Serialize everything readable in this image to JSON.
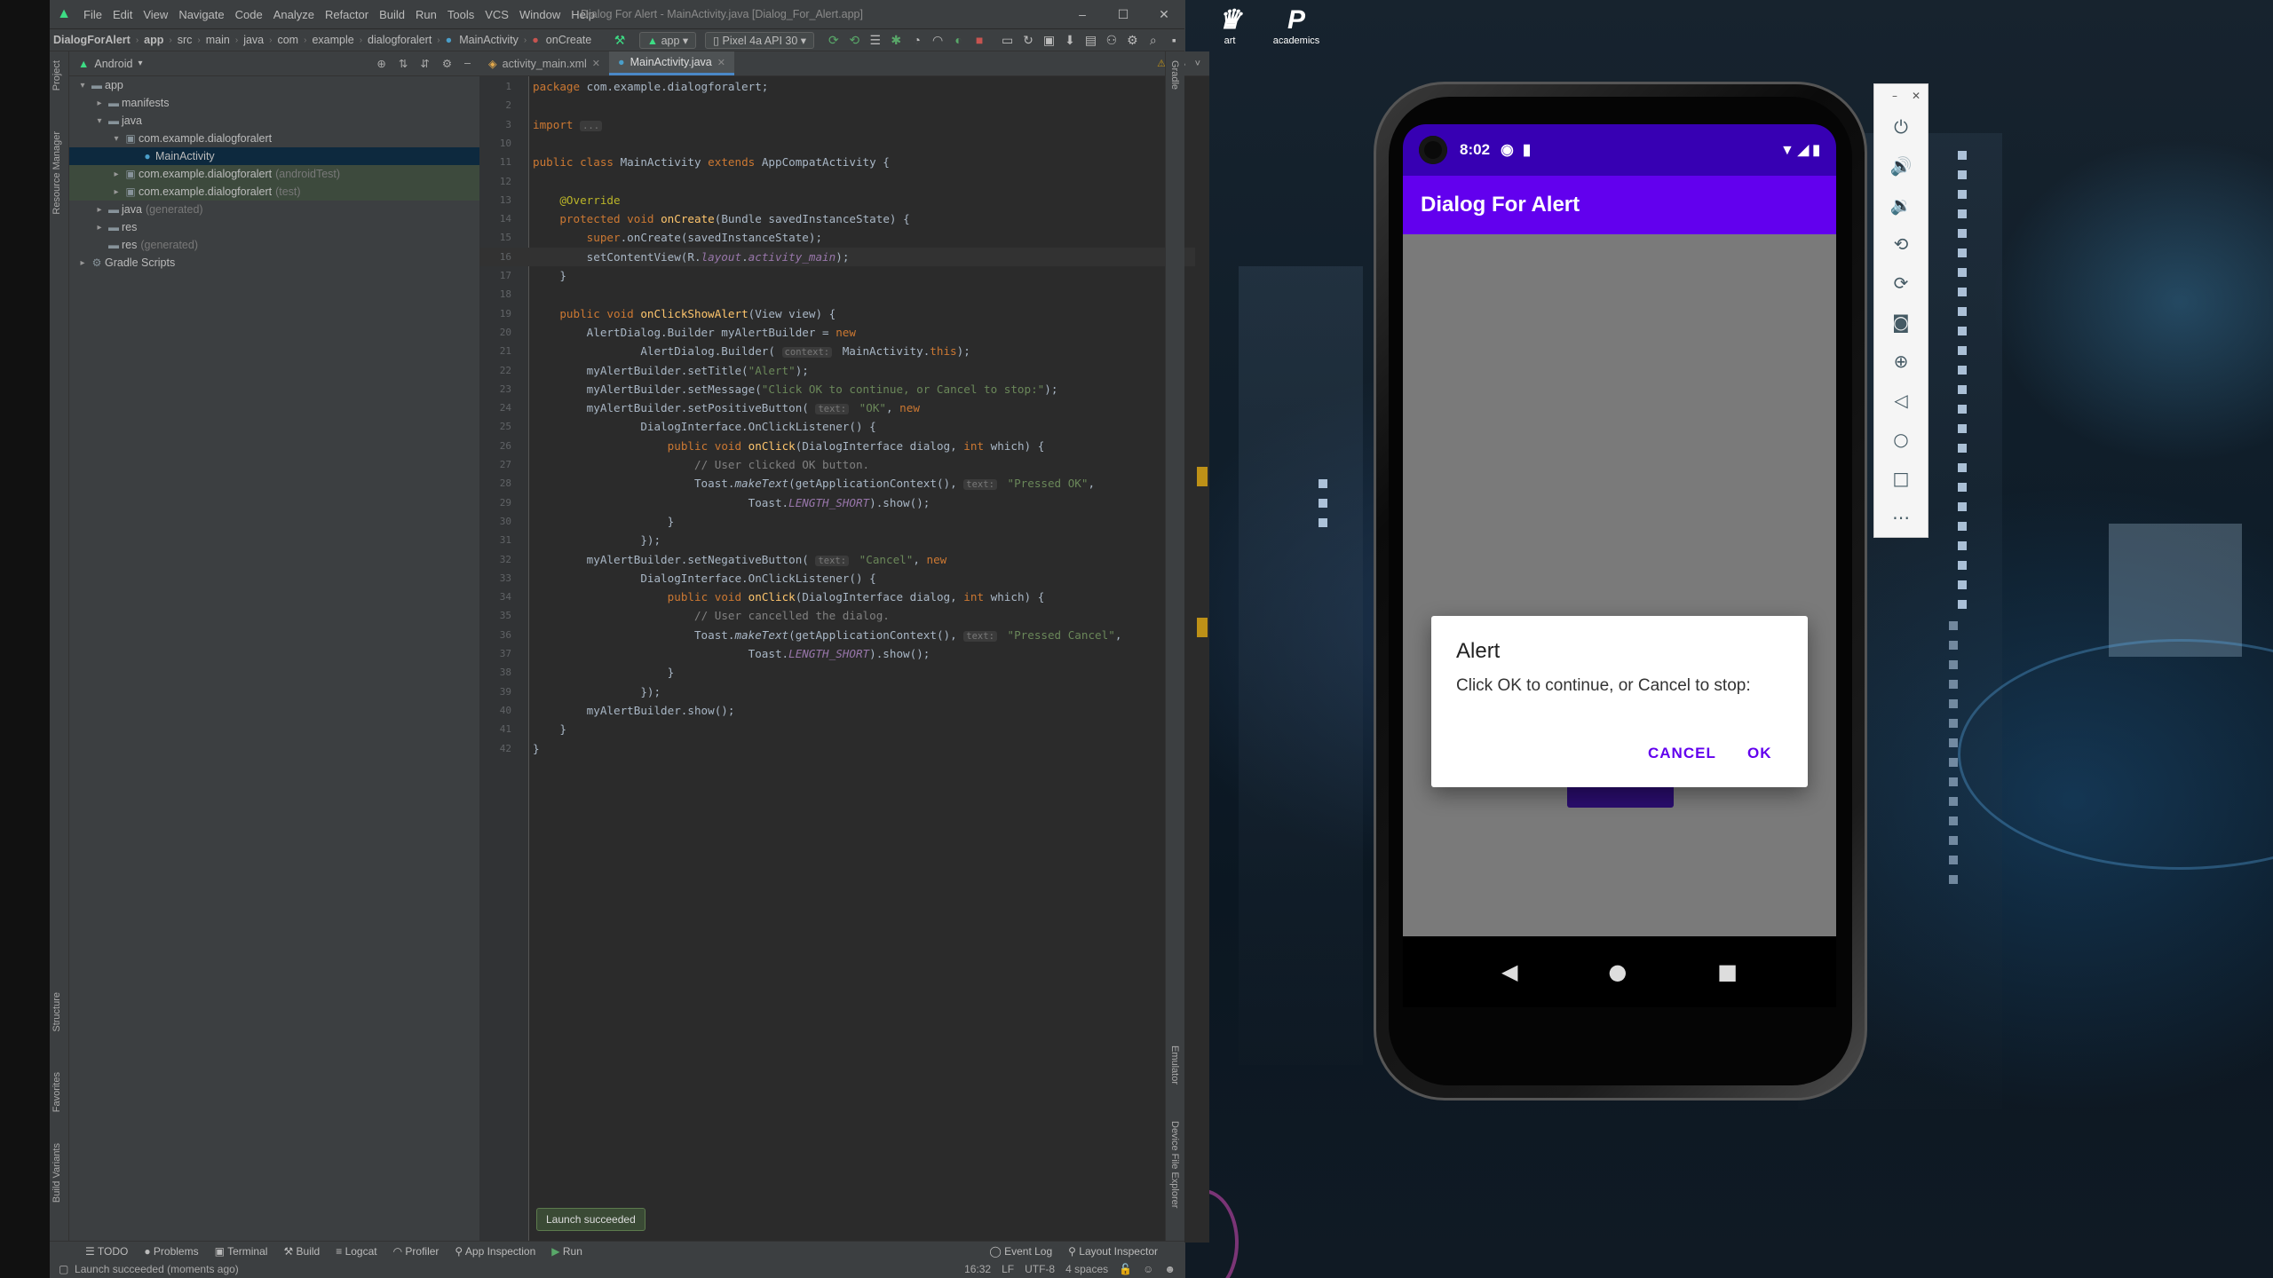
{
  "desktop": {
    "icons": [
      {
        "label": "art",
        "glyph": "♛"
      },
      {
        "label": "academics",
        "glyph": "P"
      }
    ]
  },
  "ide": {
    "menu": [
      "File",
      "Edit",
      "View",
      "Navigate",
      "Code",
      "Analyze",
      "Refactor",
      "Build",
      "Run",
      "Tools",
      "VCS",
      "Window",
      "Help"
    ],
    "window_title": "Dialog For Alert - MainActivity.java [Dialog_For_Alert.app]",
    "breadcrumbs": [
      "DialogForAlert",
      "app",
      "src",
      "main",
      "java",
      "com",
      "example",
      "dialogforalert",
      "MainActivity",
      "onCreate"
    ],
    "run_config": "app",
    "device": "Pixel 4a API 30",
    "project_view": "Android",
    "tree": [
      {
        "label": "app",
        "indent": 0,
        "arrow": "▾",
        "icon": "folder"
      },
      {
        "label": "manifests",
        "indent": 1,
        "arrow": "▸",
        "icon": "folder"
      },
      {
        "label": "java",
        "indent": 1,
        "arrow": "▾",
        "icon": "folder"
      },
      {
        "label": "com.example.dialogforalert",
        "indent": 2,
        "arrow": "▾",
        "icon": "package"
      },
      {
        "label": "MainActivity",
        "indent": 3,
        "arrow": "",
        "icon": "class",
        "selected": true
      },
      {
        "label": "com.example.dialogforalert",
        "suffix": "(androidTest)",
        "indent": 2,
        "arrow": "▸",
        "icon": "package",
        "test": true
      },
      {
        "label": "com.example.dialogforalert",
        "suffix": "(test)",
        "indent": 2,
        "arrow": "▸",
        "icon": "package",
        "test": true
      },
      {
        "label": "java",
        "suffix": "(generated)",
        "indent": 1,
        "arrow": "▸",
        "icon": "folder"
      },
      {
        "label": "res",
        "indent": 1,
        "arrow": "▸",
        "icon": "folder"
      },
      {
        "label": "res",
        "suffix": "(generated)",
        "indent": 1,
        "arrow": "",
        "icon": "folder"
      },
      {
        "label": "Gradle Scripts",
        "indent": 0,
        "arrow": "▸",
        "icon": "gradle"
      }
    ],
    "tabs": [
      {
        "label": "activity_main.xml",
        "active": false
      },
      {
        "label": "MainActivity.java",
        "active": true
      }
    ],
    "warnings": "⚠2",
    "code_lines": [
      {
        "n": "1",
        "html": "<span class='kw'>package</span> com.example.dialogforalert;"
      },
      {
        "n": "2",
        "html": ""
      },
      {
        "n": "3",
        "html": "<span class='kw'>import</span> <span class='hint'>...</span>"
      },
      {
        "n": "10",
        "html": ""
      },
      {
        "n": "11",
        "html": "<span class='kw'>public class</span> MainActivity <span class='kw'>extends</span> AppCompatActivity {"
      },
      {
        "n": "12",
        "html": ""
      },
      {
        "n": "13",
        "html": "    <span class='ann'>@Override</span>"
      },
      {
        "n": "14",
        "html": "    <span class='kw'>protected void</span> <span class='fn'>onCreate</span>(Bundle savedInstanceState) {"
      },
      {
        "n": "15",
        "html": "        <span class='kw'>super</span>.onCreate(savedInstanceState);"
      },
      {
        "n": "16",
        "html": "        setContentView(R.<span class='it'>layout</span>.<span class='it'>activity_main</span>);",
        "current": true
      },
      {
        "n": "17",
        "html": "    }"
      },
      {
        "n": "18",
        "html": ""
      },
      {
        "n": "19",
        "html": "    <span class='kw'>public void</span> <span class='fn'>onClickShowAlert</span>(View view) {"
      },
      {
        "n": "20",
        "html": "        AlertDialog.Builder myAlertBuilder = <span class='kw'>new</span>"
      },
      {
        "n": "21",
        "html": "                AlertDialog.Builder( <span class='hint'>context:</span> MainActivity.<span class='kw'>this</span>);"
      },
      {
        "n": "22",
        "html": "        myAlertBuilder.setTitle(<span class='str'>\"Alert\"</span>);"
      },
      {
        "n": "23",
        "html": "        myAlertBuilder.setMessage(<span class='str'>\"Click OK to continue, or Cancel to stop:\"</span>);"
      },
      {
        "n": "24",
        "html": "        myAlertBuilder.setPositiveButton( <span class='hint'>text:</span> <span class='str'>\"OK\"</span>, <span class='kw'>new</span>"
      },
      {
        "n": "25",
        "html": "                DialogInterface.OnClickListener() {"
      },
      {
        "n": "26",
        "html": "                    <span class='kw'>public void</span> <span class='fn'>onClick</span>(DialogInterface dialog, <span class='kw'>int</span> which) {"
      },
      {
        "n": "27",
        "html": "                        <span class='cmt'>// User clicked OK button.</span>"
      },
      {
        "n": "28",
        "html": "                        Toast.<span class='sfn'>makeText</span>(getApplicationContext(), <span class='hint'>text:</span> <span class='str'>\"Pressed OK\"</span>,"
      },
      {
        "n": "29",
        "html": "                                Toast.<span class='it'>LENGTH_SHORT</span>).show();"
      },
      {
        "n": "30",
        "html": "                    }"
      },
      {
        "n": "31",
        "html": "                });"
      },
      {
        "n": "32",
        "html": "        myAlertBuilder.setNegativeButton( <span class='hint'>text:</span> <span class='str'>\"Cancel\"</span>, <span class='kw'>new</span>"
      },
      {
        "n": "33",
        "html": "                DialogInterface.OnClickListener() {"
      },
      {
        "n": "34",
        "html": "                    <span class='kw'>public void</span> <span class='fn'>onClick</span>(DialogInterface dialog, <span class='kw'>int</span> which) {"
      },
      {
        "n": "35",
        "html": "                        <span class='cmt'>// User cancelled the dialog.</span>"
      },
      {
        "n": "36",
        "html": "                        Toast.<span class='sfn'>makeText</span>(getApplicationContext(), <span class='hint'>text:</span> <span class='str'>\"Pressed Cancel\"</span>,"
      },
      {
        "n": "37",
        "html": "                                Toast.<span class='it'>LENGTH_SHORT</span>).show();"
      },
      {
        "n": "38",
        "html": "                    }"
      },
      {
        "n": "39",
        "html": "                });"
      },
      {
        "n": "40",
        "html": "        myAlertBuilder.show();"
      },
      {
        "n": "41",
        "html": "    }"
      },
      {
        "n": "42",
        "html": "}"
      }
    ],
    "tool_windows_left": [
      "TODO",
      "Problems",
      "Terminal",
      "Build",
      "Logcat",
      "Profiler",
      "App Inspection",
      "Run"
    ],
    "tool_windows_right": [
      "Event Log",
      "Layout Inspector"
    ],
    "side_tabs_left": [
      "Project",
      "Resource Manager",
      "Structure",
      "Favorites",
      "Build Variants"
    ],
    "side_tabs_right": [
      "Gradle",
      "Emulator",
      "Device File Explorer"
    ],
    "status_message": "Launch succeeded (moments ago)",
    "status_right": [
      "16:32",
      "LF",
      "UTF-8",
      "4 spaces"
    ],
    "toast": "Launch succeeded"
  },
  "emulator": {
    "time": "8:02",
    "app_title": "Dialog For Alert",
    "dialog": {
      "title": "Alert",
      "message": "Click OK to continue, or Cancel to stop:",
      "negative": "CANCEL",
      "positive": "OK"
    },
    "tools": [
      "power-icon",
      "volume-up-icon",
      "volume-down-icon",
      "rotate-left-icon",
      "rotate-right-icon",
      "camera-icon",
      "zoom-icon",
      "back-icon",
      "home-icon",
      "overview-icon",
      "more-icon"
    ]
  }
}
